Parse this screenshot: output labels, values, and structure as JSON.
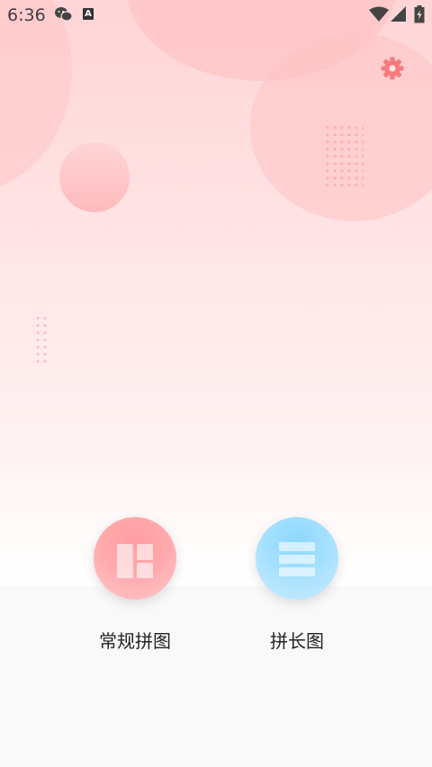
{
  "status_bar": {
    "time": "6:36",
    "icons": [
      "wechat-icon",
      "a-notification-icon",
      "wifi-icon",
      "signal-icon",
      "battery-charging-icon"
    ]
  },
  "header": {
    "settings_icon": "gear-icon",
    "accent_color": "#f7797d"
  },
  "actions": [
    {
      "label": "常规拼图",
      "icon": "grid-collage-icon",
      "color": "#ff9ea1"
    },
    {
      "label": "拼长图",
      "icon": "long-stack-icon",
      "color": "#8ed8ff"
    }
  ]
}
